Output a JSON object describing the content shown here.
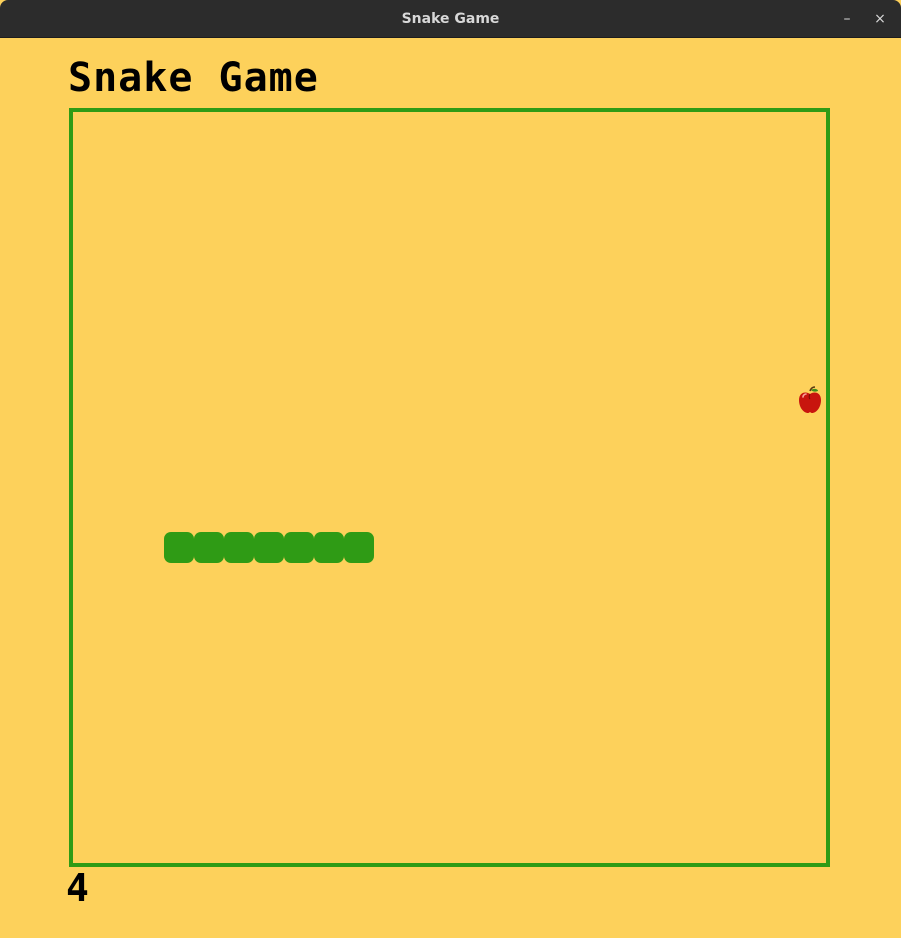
{
  "window": {
    "title": "Snake Game",
    "minimize_label": "–",
    "close_label": "×"
  },
  "game": {
    "title": "Snake Game",
    "score": "4",
    "snake_length": 7,
    "snake_direction": "horizontal",
    "food_icon": "apple-icon"
  },
  "colors": {
    "background": "#fdd15b",
    "board_border": "#2f9b15",
    "snake": "#2f9b15",
    "apple": "#d11a12",
    "titlebar": "#2c2c2c",
    "text": "#000000"
  }
}
